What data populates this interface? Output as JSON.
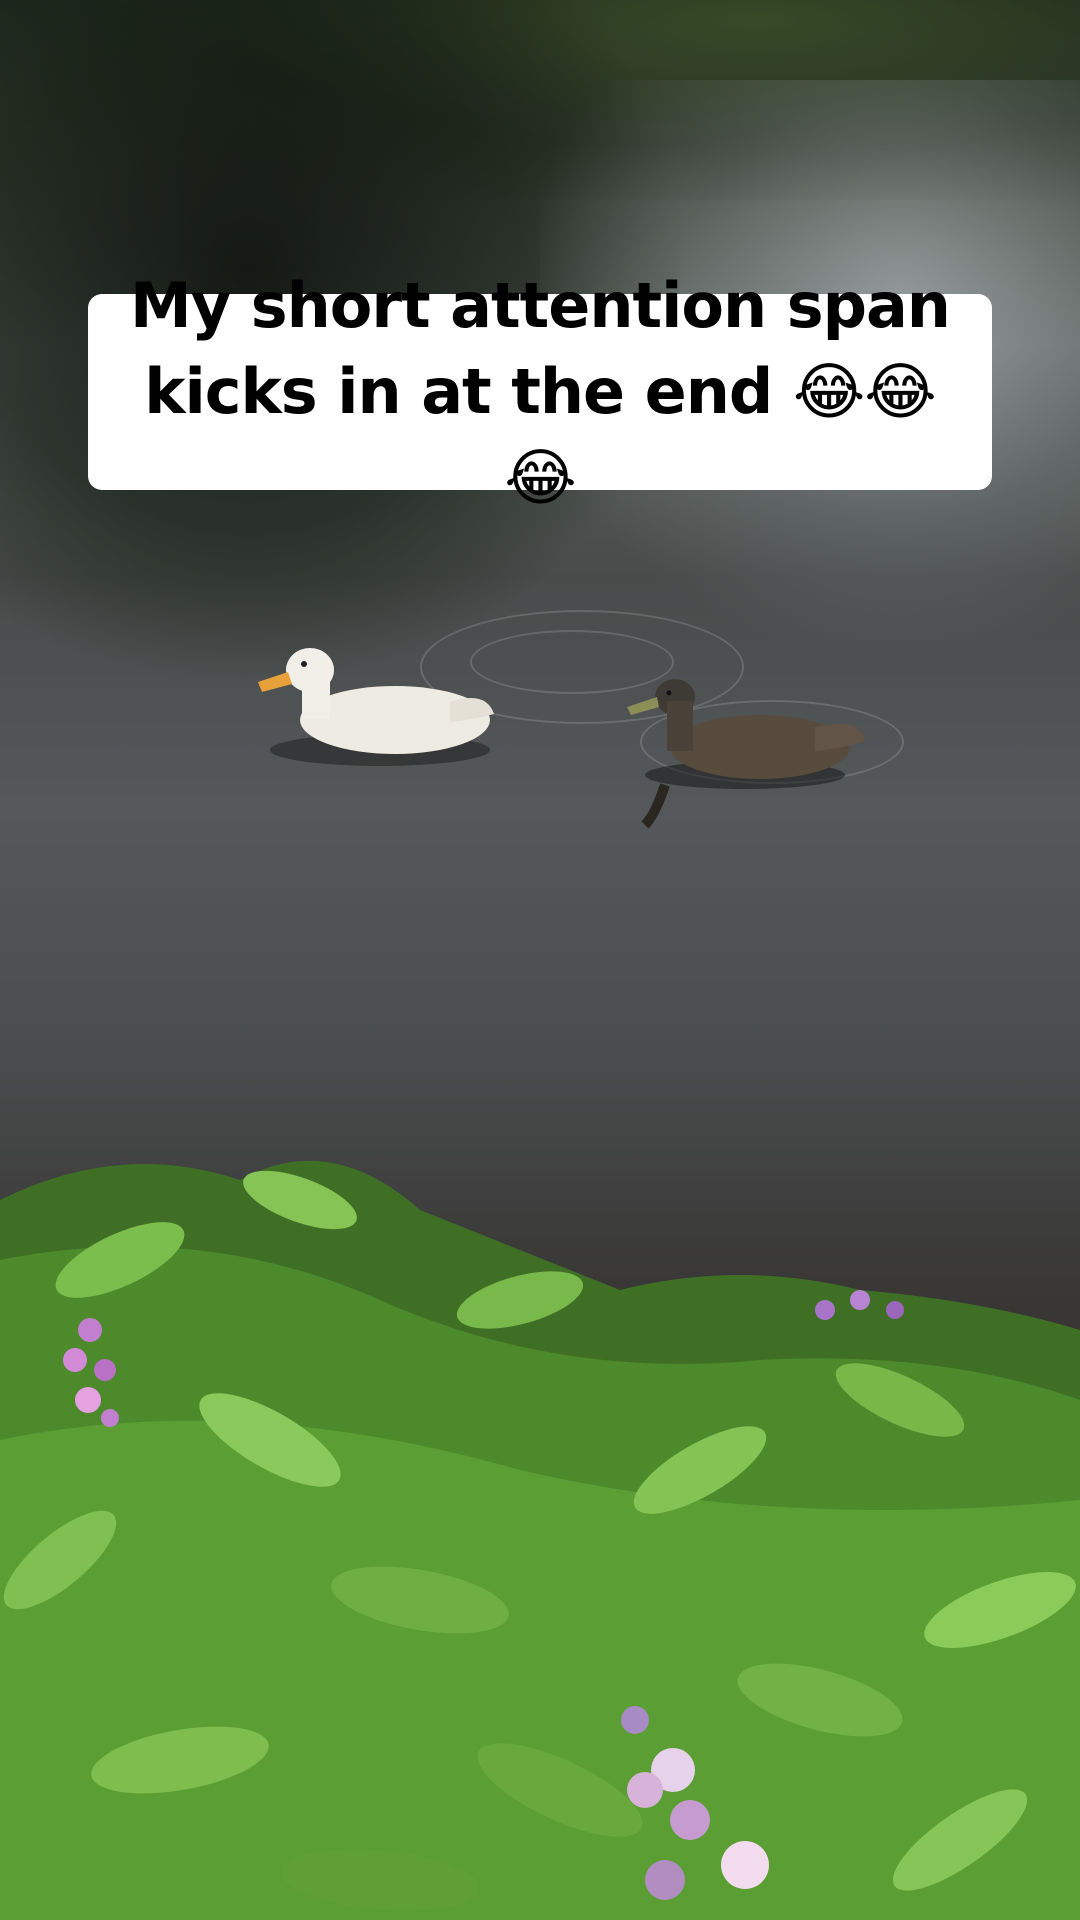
{
  "caption": {
    "text": "My short attention span\nkicks in at the end 😂😂😂"
  },
  "scene": {
    "subject_icons": [
      "white-duck-icon",
      "brown-duck-icon",
      "plants-icon",
      "flower-icon"
    ],
    "colors": {
      "caption_bg": "#ffffff",
      "caption_text": "#000000",
      "water": "#4a4c4d",
      "foliage": "#5f9a32",
      "flower": "#b88ac9"
    }
  }
}
